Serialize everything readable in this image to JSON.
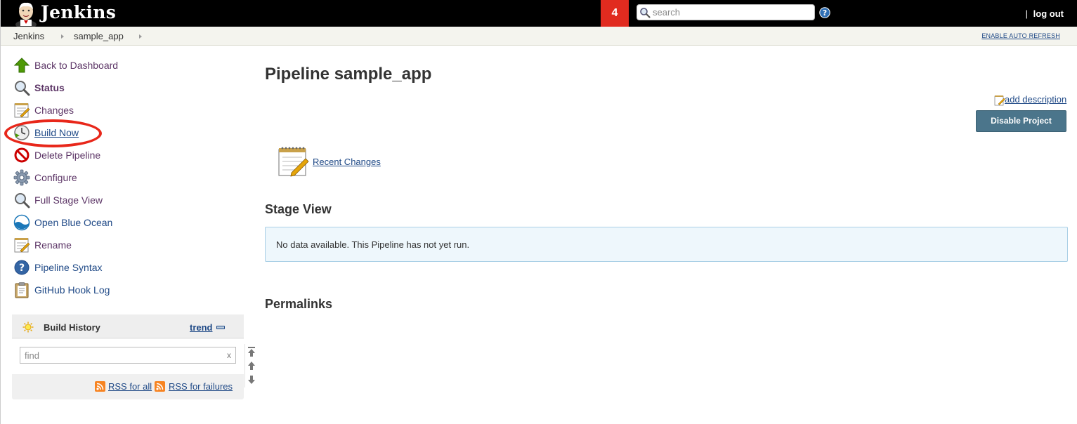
{
  "header": {
    "brand": "Jenkins",
    "notification_count": "4",
    "search": {
      "placeholder": "search",
      "value": ""
    },
    "logout_separator": "|",
    "logout_label": "log out"
  },
  "breadcrumb": {
    "items": [
      "Jenkins",
      "sample_app"
    ],
    "auto_refresh_label": "ENABLE AUTO REFRESH"
  },
  "sidebar": {
    "tasks": [
      {
        "label": "Back to Dashboard",
        "icon": "up-arrow-icon"
      },
      {
        "label": "Status",
        "icon": "magnifier-icon"
      },
      {
        "label": "Changes",
        "icon": "notepad-icon"
      },
      {
        "label": "Build Now",
        "icon": "clock-icon"
      },
      {
        "label": "Delete Pipeline",
        "icon": "no-entry-icon"
      },
      {
        "label": "Configure",
        "icon": "gear-icon"
      },
      {
        "label": "Full Stage View",
        "icon": "magnifier-icon"
      },
      {
        "label": "Open Blue Ocean",
        "icon": "blue-ocean-icon"
      },
      {
        "label": "Rename",
        "icon": "notepad-icon"
      },
      {
        "label": "Pipeline Syntax",
        "icon": "help-icon"
      },
      {
        "label": "GitHub Hook Log",
        "icon": "clipboard-icon"
      }
    ],
    "highlighted_task": "Build Now"
  },
  "build_history": {
    "title": "Build History",
    "trend_label": "trend",
    "find_placeholder": "find",
    "clear_label": "x",
    "rss_all_label": "RSS for all",
    "rss_failures_label": "RSS for failures"
  },
  "main": {
    "title": "Pipeline sample_app",
    "add_description_label": "add description",
    "disable_button_label": "Disable Project",
    "recent_changes_label": "Recent Changes",
    "stage_view_title": "Stage View",
    "stage_view_message": "No data available. This Pipeline has not yet run.",
    "permalinks_title": "Permalinks"
  },
  "colors": {
    "header_bg": "#000000",
    "notification_bg": "#e12b1f",
    "link": "#204a87",
    "visited_link": "#5c3566",
    "button_bg": "#4b758b",
    "highlight_oval": "#e8271a",
    "stage_view_bg": "#eef7fc"
  }
}
